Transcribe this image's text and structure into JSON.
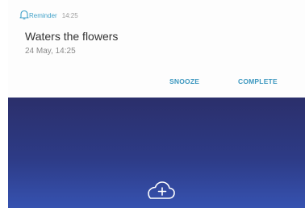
{
  "notification": {
    "app_name": "Reminder",
    "time": "14:25",
    "title": "Waters the flowers",
    "subtitle": "24 May, 14:25",
    "actions": {
      "snooze_label": "SNOOZE",
      "complete_label": "COMPLETE"
    },
    "icon": "bell-icon",
    "accent_color": "#3b97bf"
  },
  "wallpaper": {
    "colors": [
      "#2b2f6b",
      "#3652b0"
    ],
    "icon": "cloud-add-icon"
  }
}
